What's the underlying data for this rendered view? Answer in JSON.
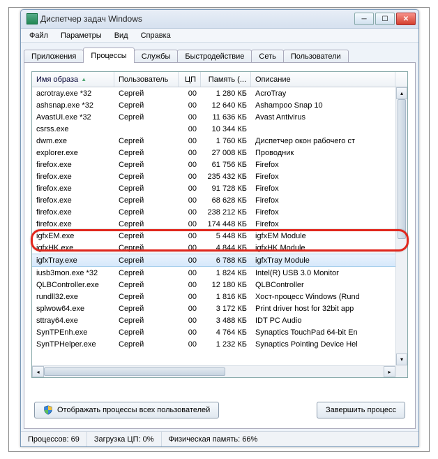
{
  "window": {
    "title": "Диспетчер задач Windows"
  },
  "menu": {
    "file": "Файл",
    "options": "Параметры",
    "view": "Вид",
    "help": "Справка"
  },
  "tabs": {
    "apps": "Приложения",
    "processes": "Процессы",
    "services": "Службы",
    "performance": "Быстродействие",
    "network": "Сеть",
    "users": "Пользователи"
  },
  "columns": {
    "name": "Имя образа",
    "user": "Пользователь",
    "cpu": "ЦП",
    "mem": "Память (...",
    "desc": "Описание"
  },
  "rows": [
    {
      "name": "acrotray.exe *32",
      "user": "Сергей",
      "cpu": "00",
      "mem": "1 280 КБ",
      "desc": "AcroTray"
    },
    {
      "name": "ashsnap.exe *32",
      "user": "Сергей",
      "cpu": "00",
      "mem": "12 640 КБ",
      "desc": "Ashampoo Snap 10"
    },
    {
      "name": "AvastUI.exe *32",
      "user": "Сергей",
      "cpu": "00",
      "mem": "11 636 КБ",
      "desc": "Avast Antivirus"
    },
    {
      "name": "csrss.exe",
      "user": "",
      "cpu": "00",
      "mem": "10 344 КБ",
      "desc": ""
    },
    {
      "name": "dwm.exe",
      "user": "Сергей",
      "cpu": "00",
      "mem": "1 760 КБ",
      "desc": "Диспетчер окон рабочего ст"
    },
    {
      "name": "explorer.exe",
      "user": "Сергей",
      "cpu": "00",
      "mem": "27 008 КБ",
      "desc": "Проводник"
    },
    {
      "name": "firefox.exe",
      "user": "Сергей",
      "cpu": "00",
      "mem": "61 756 КБ",
      "desc": "Firefox"
    },
    {
      "name": "firefox.exe",
      "user": "Сергей",
      "cpu": "00",
      "mem": "235 432 КБ",
      "desc": "Firefox"
    },
    {
      "name": "firefox.exe",
      "user": "Сергей",
      "cpu": "00",
      "mem": "91 728 КБ",
      "desc": "Firefox"
    },
    {
      "name": "firefox.exe",
      "user": "Сергей",
      "cpu": "00",
      "mem": "68 628 КБ",
      "desc": "Firefox"
    },
    {
      "name": "firefox.exe",
      "user": "Сергей",
      "cpu": "00",
      "mem": "238 212 КБ",
      "desc": "Firefox"
    },
    {
      "name": "firefox.exe",
      "user": "Сергей",
      "cpu": "00",
      "mem": "174 448 КБ",
      "desc": "Firefox"
    },
    {
      "name": "igfxEM.exe",
      "user": "Сергей",
      "cpu": "00",
      "mem": "5 448 КБ",
      "desc": "igfxEM Module"
    },
    {
      "name": "igfxHK.exe",
      "user": "Сергей",
      "cpu": "00",
      "mem": "4 844 КБ",
      "desc": "igfxHK Module"
    },
    {
      "name": "igfxTray.exe",
      "user": "Сергей",
      "cpu": "00",
      "mem": "6 788 КБ",
      "desc": "igfxTray Module",
      "selected": true
    },
    {
      "name": "iusb3mon.exe *32",
      "user": "Сергей",
      "cpu": "00",
      "mem": "1 824 КБ",
      "desc": "Intel(R) USB 3.0 Monitor"
    },
    {
      "name": "QLBController.exe",
      "user": "Сергей",
      "cpu": "00",
      "mem": "12 180 КБ",
      "desc": "QLBController"
    },
    {
      "name": "rundll32.exe",
      "user": "Сергей",
      "cpu": "00",
      "mem": "1 816 КБ",
      "desc": "Хост-процесс Windows (Rund"
    },
    {
      "name": "splwow64.exe",
      "user": "Сергей",
      "cpu": "00",
      "mem": "3 172 КБ",
      "desc": "Print driver host for 32bit app"
    },
    {
      "name": "sttray64.exe",
      "user": "Сергей",
      "cpu": "00",
      "mem": "3 488 КБ",
      "desc": "IDT PC Audio"
    },
    {
      "name": "SynTPEnh.exe",
      "user": "Сергей",
      "cpu": "00",
      "mem": "4 764 КБ",
      "desc": "Synaptics TouchPad 64-bit En"
    },
    {
      "name": "SynTPHelper.exe",
      "user": "Сергей",
      "cpu": "00",
      "mem": "1 232 КБ",
      "desc": "Synaptics Pointing Device Hel"
    }
  ],
  "buttons": {
    "show_all_users": "Отображать процессы всех пользователей",
    "end_process": "Завершить процесс"
  },
  "status": {
    "processes_label": "Процессов:",
    "processes_value": "69",
    "cpu_label": "Загрузка ЦП:",
    "cpu_value": "0%",
    "mem_label": "Физическая память:",
    "mem_value": "66%"
  }
}
